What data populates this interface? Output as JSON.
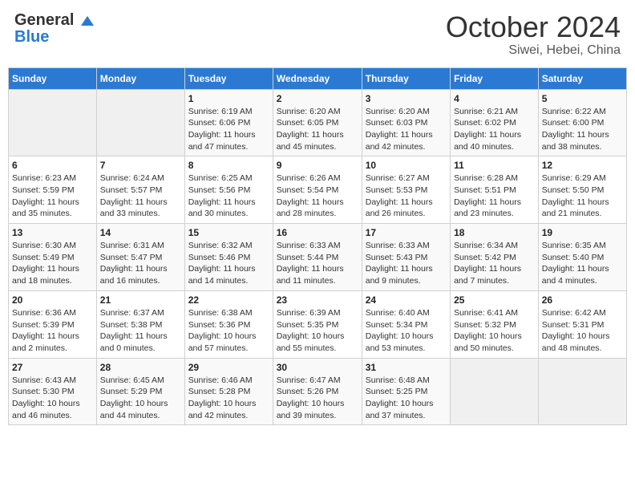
{
  "header": {
    "logo_general": "General",
    "logo_blue": "Blue",
    "month": "October 2024",
    "location": "Siwei, Hebei, China"
  },
  "weekdays": [
    "Sunday",
    "Monday",
    "Tuesday",
    "Wednesday",
    "Thursday",
    "Friday",
    "Saturday"
  ],
  "weeks": [
    [
      {
        "day": "",
        "sunrise": "",
        "sunset": "",
        "daylight": "",
        "empty": true
      },
      {
        "day": "",
        "sunrise": "",
        "sunset": "",
        "daylight": "",
        "empty": true
      },
      {
        "day": "1",
        "sunrise": "Sunrise: 6:19 AM",
        "sunset": "Sunset: 6:06 PM",
        "daylight": "Daylight: 11 hours and 47 minutes."
      },
      {
        "day": "2",
        "sunrise": "Sunrise: 6:20 AM",
        "sunset": "Sunset: 6:05 PM",
        "daylight": "Daylight: 11 hours and 45 minutes."
      },
      {
        "day": "3",
        "sunrise": "Sunrise: 6:20 AM",
        "sunset": "Sunset: 6:03 PM",
        "daylight": "Daylight: 11 hours and 42 minutes."
      },
      {
        "day": "4",
        "sunrise": "Sunrise: 6:21 AM",
        "sunset": "Sunset: 6:02 PM",
        "daylight": "Daylight: 11 hours and 40 minutes."
      },
      {
        "day": "5",
        "sunrise": "Sunrise: 6:22 AM",
        "sunset": "Sunset: 6:00 PM",
        "daylight": "Daylight: 11 hours and 38 minutes."
      }
    ],
    [
      {
        "day": "6",
        "sunrise": "Sunrise: 6:23 AM",
        "sunset": "Sunset: 5:59 PM",
        "daylight": "Daylight: 11 hours and 35 minutes."
      },
      {
        "day": "7",
        "sunrise": "Sunrise: 6:24 AM",
        "sunset": "Sunset: 5:57 PM",
        "daylight": "Daylight: 11 hours and 33 minutes."
      },
      {
        "day": "8",
        "sunrise": "Sunrise: 6:25 AM",
        "sunset": "Sunset: 5:56 PM",
        "daylight": "Daylight: 11 hours and 30 minutes."
      },
      {
        "day": "9",
        "sunrise": "Sunrise: 6:26 AM",
        "sunset": "Sunset: 5:54 PM",
        "daylight": "Daylight: 11 hours and 28 minutes."
      },
      {
        "day": "10",
        "sunrise": "Sunrise: 6:27 AM",
        "sunset": "Sunset: 5:53 PM",
        "daylight": "Daylight: 11 hours and 26 minutes."
      },
      {
        "day": "11",
        "sunrise": "Sunrise: 6:28 AM",
        "sunset": "Sunset: 5:51 PM",
        "daylight": "Daylight: 11 hours and 23 minutes."
      },
      {
        "day": "12",
        "sunrise": "Sunrise: 6:29 AM",
        "sunset": "Sunset: 5:50 PM",
        "daylight": "Daylight: 11 hours and 21 minutes."
      }
    ],
    [
      {
        "day": "13",
        "sunrise": "Sunrise: 6:30 AM",
        "sunset": "Sunset: 5:49 PM",
        "daylight": "Daylight: 11 hours and 18 minutes."
      },
      {
        "day": "14",
        "sunrise": "Sunrise: 6:31 AM",
        "sunset": "Sunset: 5:47 PM",
        "daylight": "Daylight: 11 hours and 16 minutes."
      },
      {
        "day": "15",
        "sunrise": "Sunrise: 6:32 AM",
        "sunset": "Sunset: 5:46 PM",
        "daylight": "Daylight: 11 hours and 14 minutes."
      },
      {
        "day": "16",
        "sunrise": "Sunrise: 6:33 AM",
        "sunset": "Sunset: 5:44 PM",
        "daylight": "Daylight: 11 hours and 11 minutes."
      },
      {
        "day": "17",
        "sunrise": "Sunrise: 6:33 AM",
        "sunset": "Sunset: 5:43 PM",
        "daylight": "Daylight: 11 hours and 9 minutes."
      },
      {
        "day": "18",
        "sunrise": "Sunrise: 6:34 AM",
        "sunset": "Sunset: 5:42 PM",
        "daylight": "Daylight: 11 hours and 7 minutes."
      },
      {
        "day": "19",
        "sunrise": "Sunrise: 6:35 AM",
        "sunset": "Sunset: 5:40 PM",
        "daylight": "Daylight: 11 hours and 4 minutes."
      }
    ],
    [
      {
        "day": "20",
        "sunrise": "Sunrise: 6:36 AM",
        "sunset": "Sunset: 5:39 PM",
        "daylight": "Daylight: 11 hours and 2 minutes."
      },
      {
        "day": "21",
        "sunrise": "Sunrise: 6:37 AM",
        "sunset": "Sunset: 5:38 PM",
        "daylight": "Daylight: 11 hours and 0 minutes."
      },
      {
        "day": "22",
        "sunrise": "Sunrise: 6:38 AM",
        "sunset": "Sunset: 5:36 PM",
        "daylight": "Daylight: 10 hours and 57 minutes."
      },
      {
        "day": "23",
        "sunrise": "Sunrise: 6:39 AM",
        "sunset": "Sunset: 5:35 PM",
        "daylight": "Daylight: 10 hours and 55 minutes."
      },
      {
        "day": "24",
        "sunrise": "Sunrise: 6:40 AM",
        "sunset": "Sunset: 5:34 PM",
        "daylight": "Daylight: 10 hours and 53 minutes."
      },
      {
        "day": "25",
        "sunrise": "Sunrise: 6:41 AM",
        "sunset": "Sunset: 5:32 PM",
        "daylight": "Daylight: 10 hours and 50 minutes."
      },
      {
        "day": "26",
        "sunrise": "Sunrise: 6:42 AM",
        "sunset": "Sunset: 5:31 PM",
        "daylight": "Daylight: 10 hours and 48 minutes."
      }
    ],
    [
      {
        "day": "27",
        "sunrise": "Sunrise: 6:43 AM",
        "sunset": "Sunset: 5:30 PM",
        "daylight": "Daylight: 10 hours and 46 minutes."
      },
      {
        "day": "28",
        "sunrise": "Sunrise: 6:45 AM",
        "sunset": "Sunset: 5:29 PM",
        "daylight": "Daylight: 10 hours and 44 minutes."
      },
      {
        "day": "29",
        "sunrise": "Sunrise: 6:46 AM",
        "sunset": "Sunset: 5:28 PM",
        "daylight": "Daylight: 10 hours and 42 minutes."
      },
      {
        "day": "30",
        "sunrise": "Sunrise: 6:47 AM",
        "sunset": "Sunset: 5:26 PM",
        "daylight": "Daylight: 10 hours and 39 minutes."
      },
      {
        "day": "31",
        "sunrise": "Sunrise: 6:48 AM",
        "sunset": "Sunset: 5:25 PM",
        "daylight": "Daylight: 10 hours and 37 minutes."
      },
      {
        "day": "",
        "sunrise": "",
        "sunset": "",
        "daylight": "",
        "empty": true
      },
      {
        "day": "",
        "sunrise": "",
        "sunset": "",
        "daylight": "",
        "empty": true
      }
    ]
  ]
}
